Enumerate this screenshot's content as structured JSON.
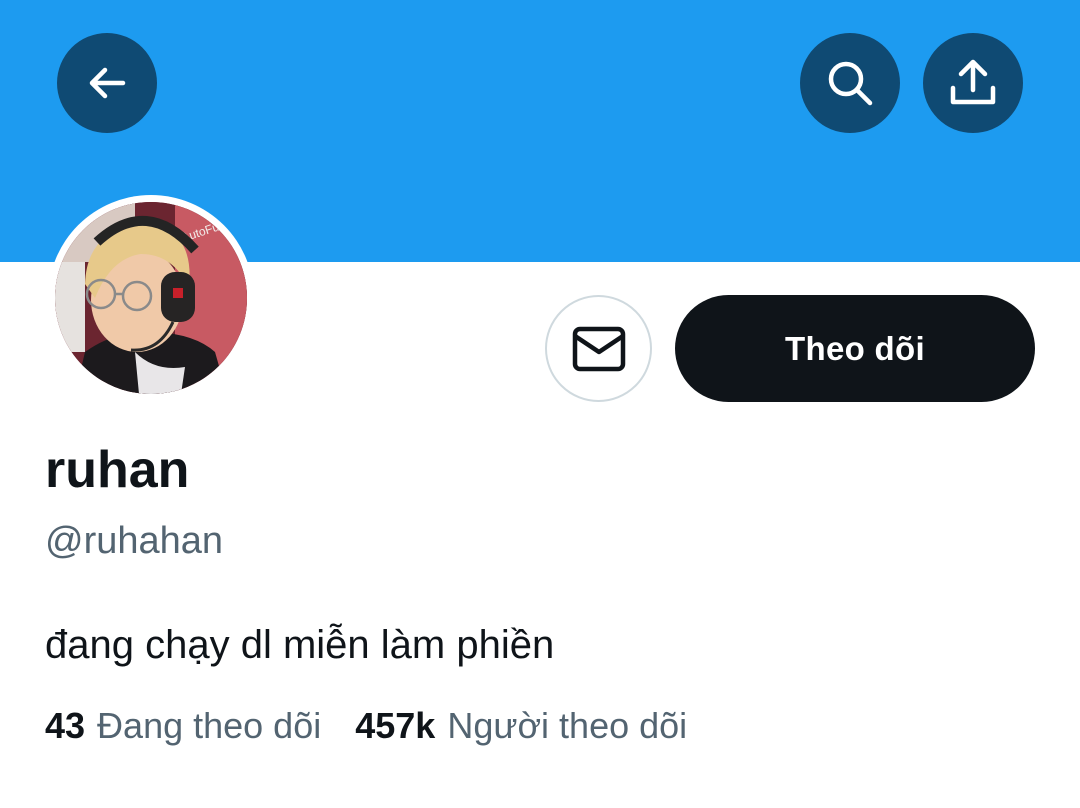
{
  "header": {
    "banner_color": "#1d9bf0",
    "back_icon": "arrow-left-icon",
    "search_icon": "search-icon",
    "share_icon": "share-icon"
  },
  "profile": {
    "avatar": "profile photo",
    "avatar_text": "AutoFull",
    "display_name": "ruhan",
    "handle": "@ruhahan",
    "bio": "đang chạy dl miễn làm phiền",
    "message_icon": "envelope-icon",
    "follow_label": "Theo dõi"
  },
  "stats": {
    "following_count": "43",
    "following_label": "Đang theo dõi",
    "followers_count": "457k",
    "followers_label": "Người theo dõi"
  }
}
